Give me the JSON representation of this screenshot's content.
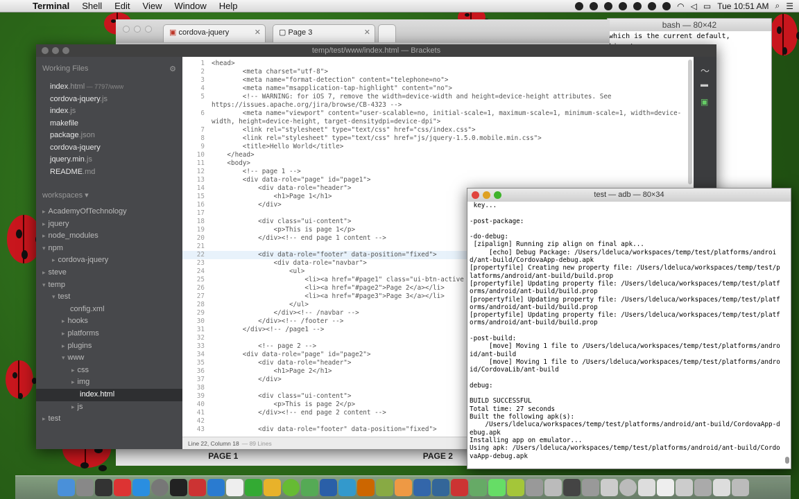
{
  "menubar": {
    "app": "Terminal",
    "items": [
      "Shell",
      "Edit",
      "View",
      "Window",
      "Help"
    ],
    "clock": "Tue 10:51 AM"
  },
  "browser": {
    "tabs": [
      "cordova-jquery",
      "Page 3"
    ],
    "bottom_tabs": [
      "PAGE 1",
      "PAGE 2"
    ]
  },
  "bash": {
    "title": "bash — 80×42",
    "lines": [
      "which is the current default,",
      "king tree"
    ]
  },
  "brackets": {
    "title": "temp/test/www/index.html — Brackets",
    "working_files_label": "Working Files",
    "working_files": [
      {
        "name": "index",
        "ext": ".html",
        "sub": " — 7797/www"
      },
      {
        "name": "cordova-jquery",
        "ext": ".js",
        "sub": ""
      },
      {
        "name": "index",
        "ext": ".js",
        "sub": ""
      },
      {
        "name": "makefile",
        "ext": "",
        "sub": ""
      },
      {
        "name": "package",
        "ext": ".json",
        "sub": ""
      },
      {
        "name": "cordova-jquery",
        "ext": "",
        "sub": ""
      },
      {
        "name": "jquery.min",
        "ext": ".js",
        "sub": ""
      },
      {
        "name": "README",
        "ext": ".md",
        "sub": ""
      }
    ],
    "workspaces_label": "workspaces ▾",
    "tree": [
      {
        "label": "AcademyOfTechnology",
        "level": 0,
        "arrow": "▸",
        "sel": false
      },
      {
        "label": "jquery",
        "level": 0,
        "arrow": "▸",
        "sel": false
      },
      {
        "label": "node_modules",
        "level": 0,
        "arrow": "▸",
        "sel": false
      },
      {
        "label": "npm",
        "level": 0,
        "arrow": "▾",
        "sel": false
      },
      {
        "label": "cordova-jquery",
        "level": 1,
        "arrow": "▸",
        "sel": false
      },
      {
        "label": "steve",
        "level": 0,
        "arrow": "▸",
        "sel": false
      },
      {
        "label": "temp",
        "level": 0,
        "arrow": "▾",
        "sel": false
      },
      {
        "label": "test",
        "level": 1,
        "arrow": "▾",
        "sel": false
      },
      {
        "label": "config.xml",
        "level": 2,
        "arrow": "",
        "sel": false
      },
      {
        "label": "hooks",
        "level": 2,
        "arrow": "▸",
        "sel": false
      },
      {
        "label": "platforms",
        "level": 2,
        "arrow": "▸",
        "sel": false
      },
      {
        "label": "plugins",
        "level": 2,
        "arrow": "▸",
        "sel": false
      },
      {
        "label": "www",
        "level": 2,
        "arrow": "▾",
        "sel": false
      },
      {
        "label": "css",
        "level": 3,
        "arrow": "▸",
        "sel": false
      },
      {
        "label": "img",
        "level": 3,
        "arrow": "▸",
        "sel": false
      },
      {
        "label": "index.html",
        "level": 3,
        "arrow": "",
        "sel": true
      },
      {
        "label": "js",
        "level": 3,
        "arrow": "▸",
        "sel": false
      },
      {
        "label": "test",
        "level": 0,
        "arrow": "▸",
        "sel": false
      }
    ],
    "code_lines": [
      {
        "n": "1",
        "t": "<head>"
      },
      {
        "n": "2",
        "t": "        <meta charset=\"utf-8\">"
      },
      {
        "n": "3",
        "t": "        <meta name=\"format-detection\" content=\"telephone=no\">"
      },
      {
        "n": "4",
        "t": "        <meta name=\"msapplication-tap-highlight\" content=\"no\">"
      },
      {
        "n": "5",
        "t": "        <!-- WARNING: for iOS 7, remove the width=device-width and height=device-height attributes. See"
      },
      {
        "n": "",
        "t": "https://issues.apache.org/jira/browse/CB-4323 -->"
      },
      {
        "n": "6",
        "t": "        <meta name=\"viewport\" content=\"user-scalable=no, initial-scale=1, maximum-scale=1, minimum-scale=1, width=device-"
      },
      {
        "n": "",
        "t": "width, height=device-height, target-densitydpi=device-dpi\">"
      },
      {
        "n": "7",
        "t": "        <link rel=\"stylesheet\" type=\"text/css\" href=\"css/index.css\">"
      },
      {
        "n": "8",
        "t": "        <link rel=\"stylesheet\" type=\"text/css\" href=\"js/jquery-1.5.0.mobile.min.css\">"
      },
      {
        "n": "9",
        "t": "        <title>Hello World</title>"
      },
      {
        "n": "10",
        "t": "    </head>"
      },
      {
        "n": "11",
        "t": "    <body>"
      },
      {
        "n": "12",
        "t": "        <!-- page 1 -->"
      },
      {
        "n": "13",
        "t": "        <div data-role=\"page\" id=\"page1\">"
      },
      {
        "n": "14",
        "t": "            <div data-role=\"header\">"
      },
      {
        "n": "15",
        "t": "                <h1>Page 1</h1>"
      },
      {
        "n": "16",
        "t": "            </div>"
      },
      {
        "n": "17",
        "t": ""
      },
      {
        "n": "18",
        "t": "            <div class=\"ui-content\">"
      },
      {
        "n": "19",
        "t": "                <p>This is page 1</p>"
      },
      {
        "n": "20",
        "t": "            </div><!-- end page 1 content -->"
      },
      {
        "n": "21",
        "t": ""
      },
      {
        "n": "22",
        "t": "            <div data-role=\"footer\" data-position=\"fixed\">"
      },
      {
        "n": "23",
        "t": "                <div data-role=\"navbar\">"
      },
      {
        "n": "24",
        "t": "                    <ul>"
      },
      {
        "n": "25",
        "t": "                        <li><a href=\"#page1\" class=\"ui-btn-active"
      },
      {
        "n": "26",
        "t": "                        <li><a href=\"#page2\">Page 2</a></li>"
      },
      {
        "n": "27",
        "t": "                        <li><a href=\"#page3\">Page 3</a></li>"
      },
      {
        "n": "28",
        "t": "                    </ul>"
      },
      {
        "n": "29",
        "t": "                </div><!-- /navbar -->"
      },
      {
        "n": "30",
        "t": "            </div><!-- /footer -->"
      },
      {
        "n": "31",
        "t": "        </div><!-- /page1 -->"
      },
      {
        "n": "32",
        "t": ""
      },
      {
        "n": "33",
        "t": "            <!-- page 2 -->"
      },
      {
        "n": "34",
        "t": "        <div data-role=\"page\" id=\"page2\">"
      },
      {
        "n": "35",
        "t": "            <div data-role=\"header\">"
      },
      {
        "n": "36",
        "t": "                <h1>Page 2</h1>"
      },
      {
        "n": "37",
        "t": "            </div>"
      },
      {
        "n": "38",
        "t": ""
      },
      {
        "n": "39",
        "t": "            <div class=\"ui-content\">"
      },
      {
        "n": "40",
        "t": "                <p>This is page 2</p>"
      },
      {
        "n": "41",
        "t": "            </div><!-- end page 2 content -->"
      },
      {
        "n": "42",
        "t": ""
      },
      {
        "n": "43",
        "t": "            <div data-role=\"footer\" data-position=\"fixed\">"
      }
    ],
    "status": "Line 22, Column 18",
    "status_lines": "— 89 Lines"
  },
  "terminal": {
    "title": "test — adb — 80×34",
    "output": " key...\n\n-post-package:\n\n-do-debug:\n [zipalign] Running zip align on final apk...\n     [echo] Debug Package: /Users/ldeluca/workspaces/temp/test/platforms/android/ant-build/CordovaApp-debug.apk\n[propertyfile] Creating new property file: /Users/ldeluca/workspaces/temp/test/platforms/android/ant-build/build.prop\n[propertyfile] Updating property file: /Users/ldeluca/workspaces/temp/test/platforms/android/ant-build/build.prop\n[propertyfile] Updating property file: /Users/ldeluca/workspaces/temp/test/platforms/android/ant-build/build.prop\n[propertyfile] Updating property file: /Users/ldeluca/workspaces/temp/test/platforms/android/ant-build/build.prop\n\n-post-build:\n     [move] Moving 1 file to /Users/ldeluca/workspaces/temp/test/platforms/android/ant-build\n     [move] Moving 1 file to /Users/ldeluca/workspaces/temp/test/platforms/android/CordovaLib/ant-build\n\ndebug:\n\nBUILD SUCCESSFUL\nTotal time: 27 seconds\nBuilt the following apk(s):\n    /Users/ldeluca/workspaces/temp/test/platforms/android/ant-build/CordovaApp-debug.apk\nInstalling app on emulator...\nUsing apk: /Users/ldeluca/workspaces/temp/test/platforms/android/ant-build/CordovaApp-debug.apk"
  },
  "dock_icons": [
    "finder-icon",
    "launchpad-icon",
    "photo-booth-icon",
    "itunes-icon",
    "app-store-icon",
    "system-preferences-icon",
    "terminal-icon",
    "itunes-icon",
    "safari-icon",
    "calendar-icon",
    "app-icon",
    "chrome-icon",
    "calculator-icon",
    "app-icon",
    "app-icon",
    "safari-icon",
    "app-icon",
    "app-icon",
    "keynote-icon",
    "app-icon",
    "app-icon",
    "app-icon",
    "network-icon",
    "app-icon",
    "android-icon",
    "app-icon",
    "app-icon",
    "app-icon",
    "app-icon",
    "app-icon",
    "app-icon",
    "app-icon",
    "app-icon",
    "app-icon",
    "app-icon",
    "app-icon",
    "trash-icon"
  ]
}
